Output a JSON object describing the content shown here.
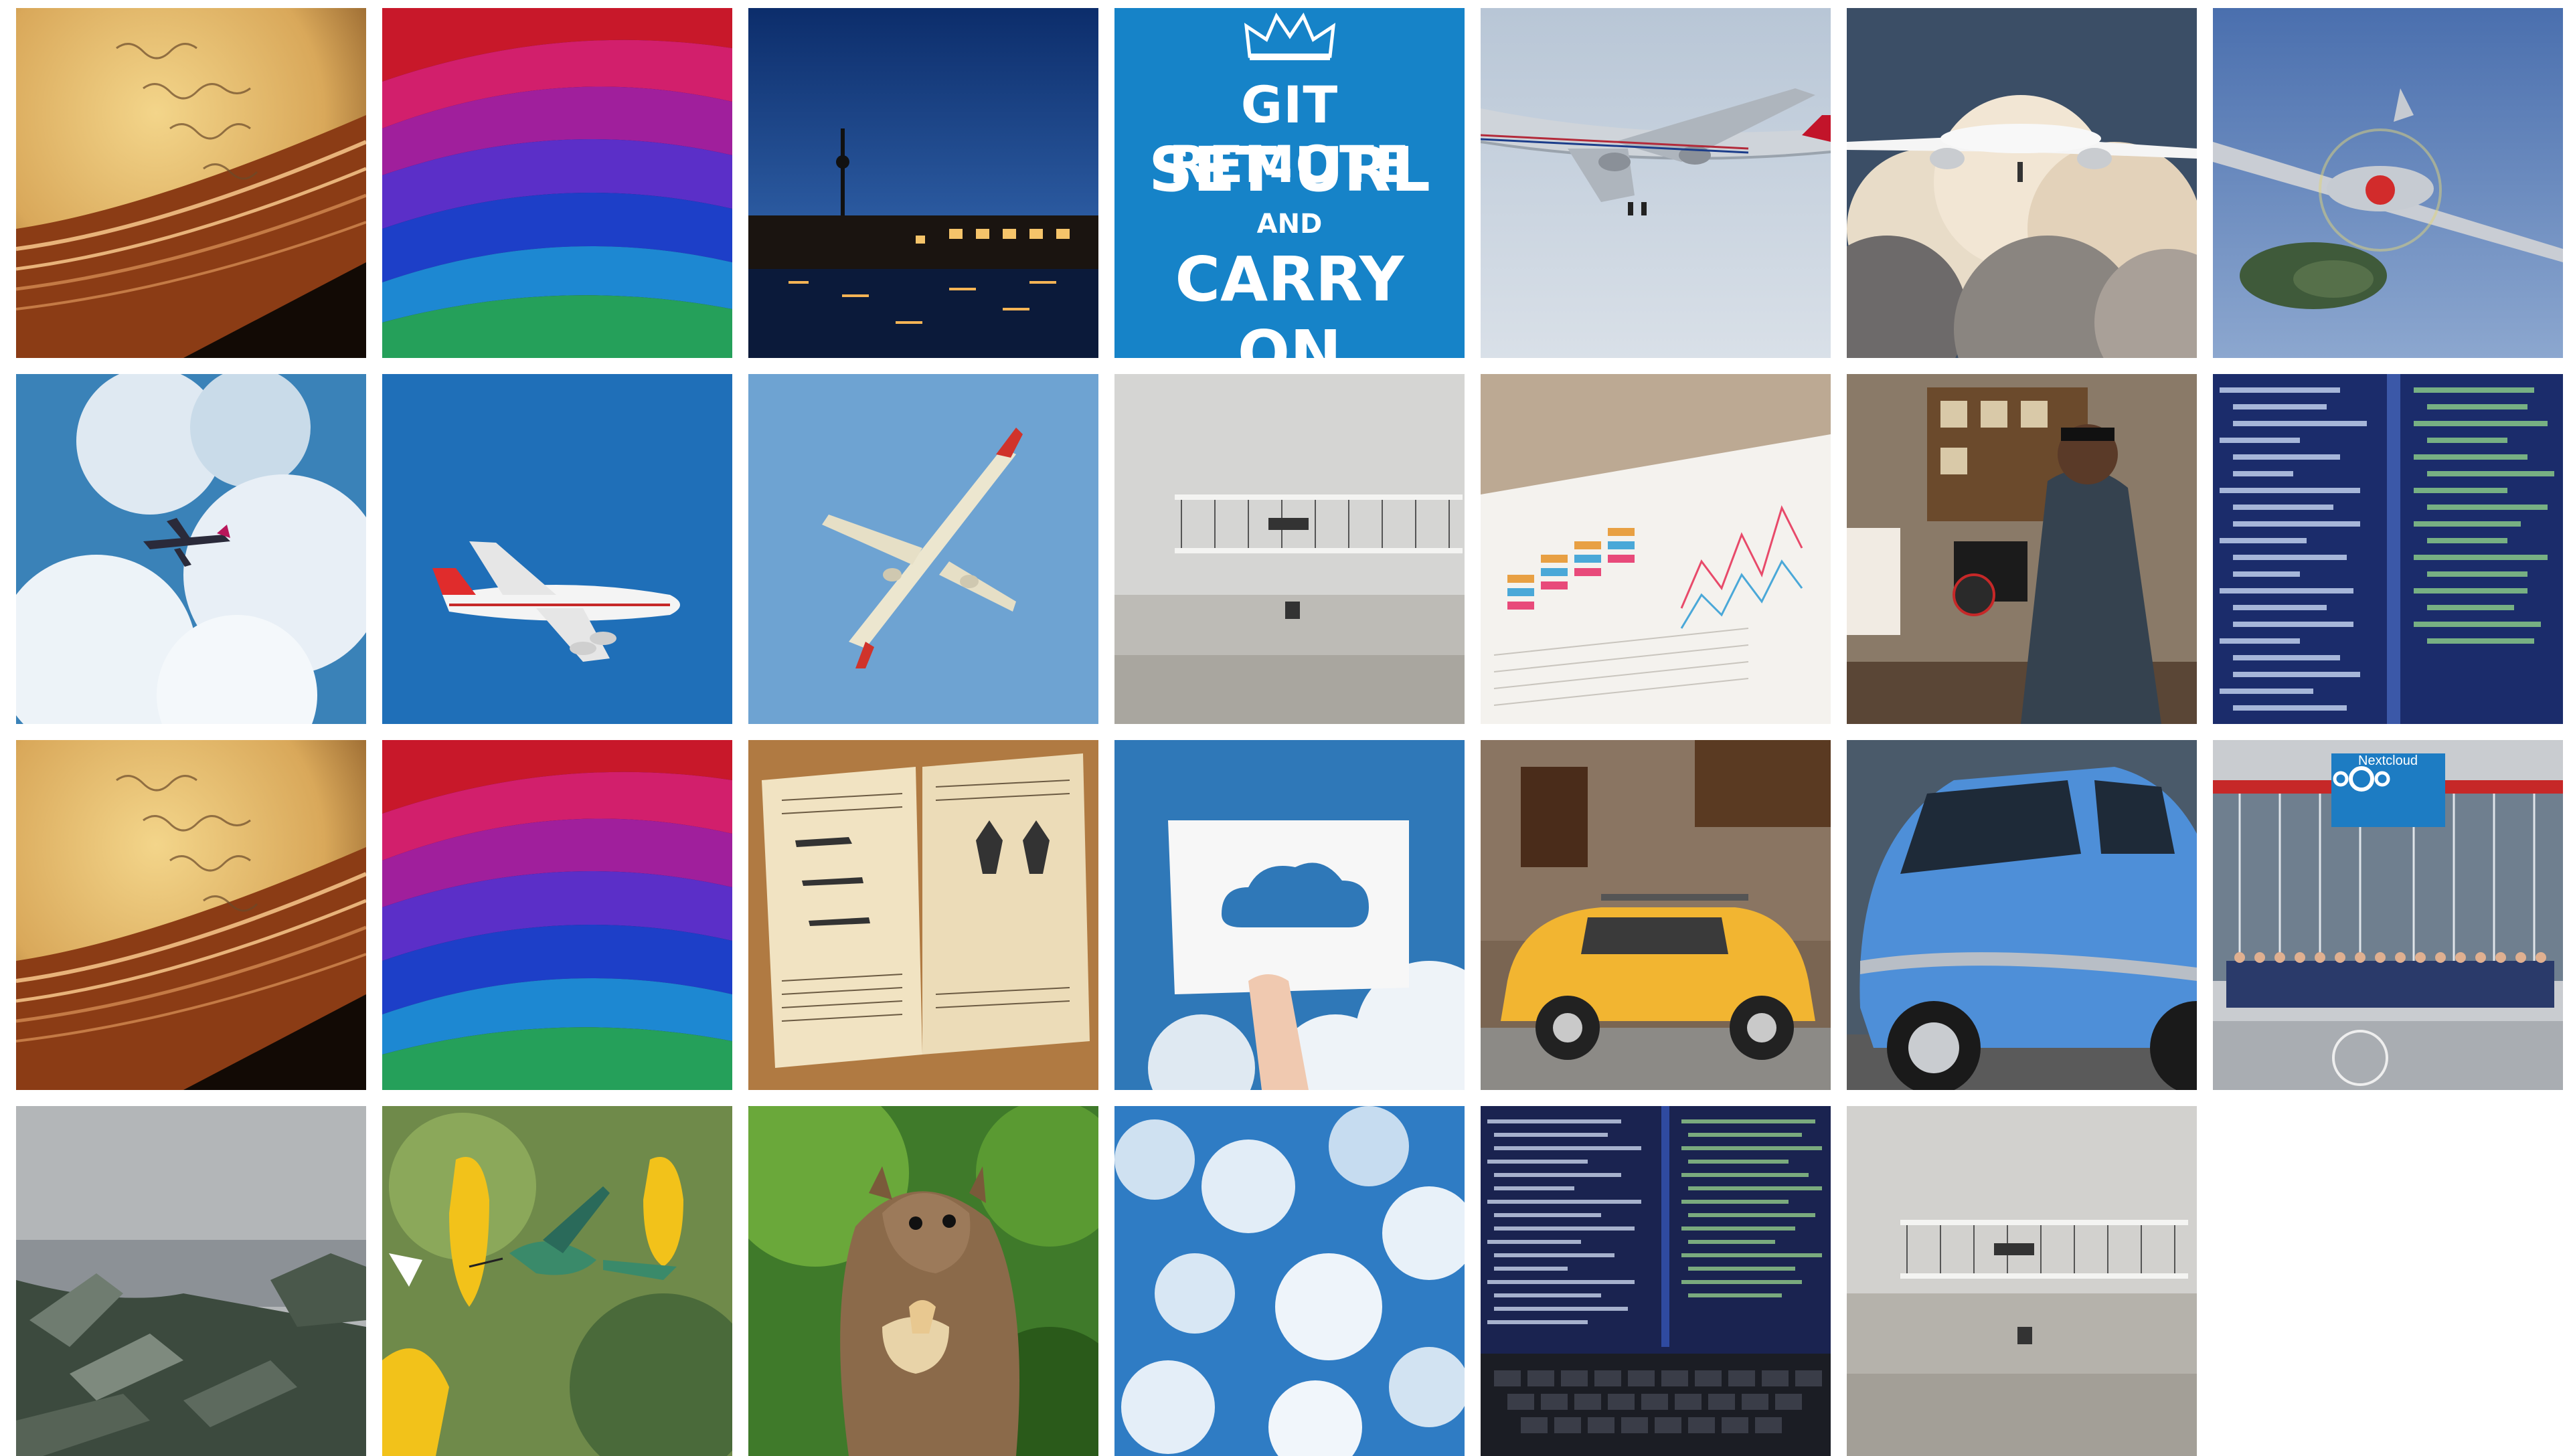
{
  "gallery": {
    "columns": 7,
    "rows": 4,
    "tiles": [
      {
        "id": "tile-1",
        "subject": "old-book-handwriting"
      },
      {
        "id": "tile-2",
        "subject": "colorful-light-streaks"
      },
      {
        "id": "tile-3",
        "subject": "city-night-tv-tower"
      },
      {
        "id": "tile-4",
        "subject": "keep-calm-poster"
      },
      {
        "id": "tile-5",
        "subject": "airliner-flying"
      },
      {
        "id": "tile-6",
        "subject": "airliner-above-clouds"
      },
      {
        "id": "tile-7",
        "subject": "propeller-warplane"
      },
      {
        "id": "tile-8",
        "subject": "plane-in-clouds"
      },
      {
        "id": "tile-9",
        "subject": "jumbo-jet-blue-sky"
      },
      {
        "id": "tile-10",
        "subject": "jet-banking-sky"
      },
      {
        "id": "tile-11",
        "subject": "wright-flyer"
      },
      {
        "id": "tile-12",
        "subject": "charts-on-paper"
      },
      {
        "id": "tile-13",
        "subject": "camera-operator"
      },
      {
        "id": "tile-14",
        "subject": "source-code-screen"
      },
      {
        "id": "tile-15",
        "subject": "old-book-handwriting"
      },
      {
        "id": "tile-16",
        "subject": "colorful-light-streaks"
      },
      {
        "id": "tile-17",
        "subject": "vintage-aircraft-book"
      },
      {
        "id": "tile-18",
        "subject": "paper-cloud-cutout"
      },
      {
        "id": "tile-19",
        "subject": "yellow-vintage-car"
      },
      {
        "id": "tile-20",
        "subject": "blue-smart-car"
      },
      {
        "id": "tile-21",
        "subject": "nextcloud-group-photo"
      },
      {
        "id": "tile-22",
        "subject": "rocky-coast"
      },
      {
        "id": "tile-23",
        "subject": "hummingbird-flowers"
      },
      {
        "id": "tile-24",
        "subject": "squirrel-eating"
      },
      {
        "id": "tile-25",
        "subject": "blue-sky-clouds"
      },
      {
        "id": "tile-26",
        "subject": "code-on-laptop"
      },
      {
        "id": "tile-27",
        "subject": "wright-flyer"
      }
    ]
  },
  "poster": {
    "line1": "GIT REMOTE",
    "line2": "SET-URL",
    "line3": "AND",
    "line4": "CARRY",
    "line5": "ON"
  },
  "nextcloud_badge": {
    "label": "Nextcloud"
  },
  "colors": {
    "poster_blue": "#1683c8",
    "sky_blue": "#2b7fc4",
    "background": "#ffffff"
  }
}
